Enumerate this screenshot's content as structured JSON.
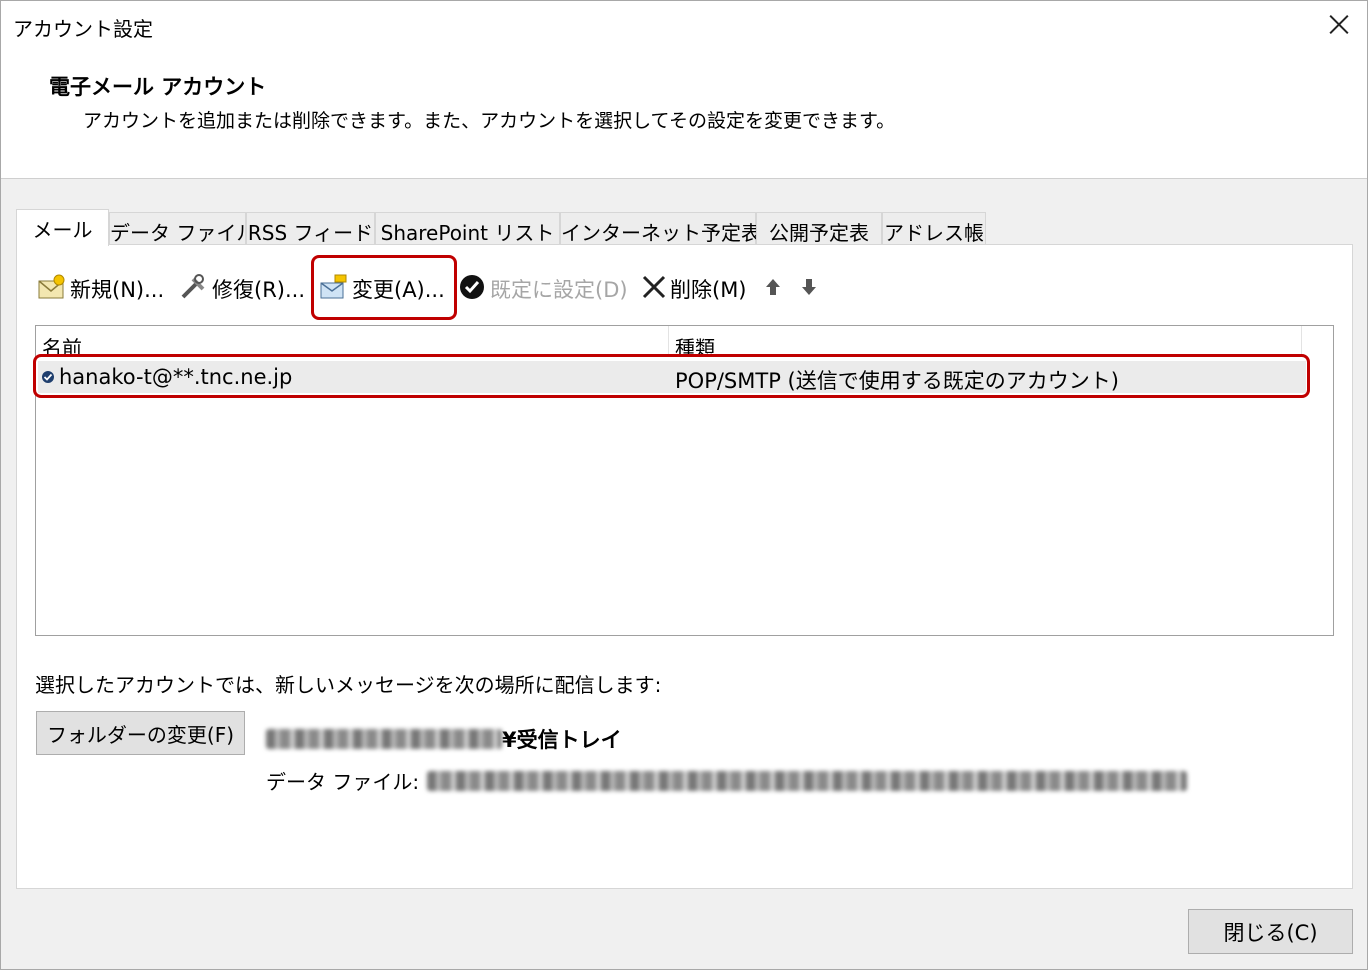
{
  "window": {
    "title": "アカウント設定"
  },
  "header": {
    "heading": "電子メール アカウント",
    "description": "アカウントを追加または削除できます。また、アカウントを選択してその設定を変更できます。"
  },
  "tabs": [
    {
      "label": "メール",
      "active": true
    },
    {
      "label": "データ ファイル"
    },
    {
      "label": "RSS フィード"
    },
    {
      "label": "SharePoint リスト"
    },
    {
      "label": "インターネット予定表"
    },
    {
      "label": "公開予定表"
    },
    {
      "label": "アドレス帳"
    }
  ],
  "toolbar": {
    "new": "新規(N)...",
    "repair": "修復(R)...",
    "change": "変更(A)...",
    "set_default": "既定に設定(D)",
    "remove": "削除(M)"
  },
  "list": {
    "columns": [
      "名前",
      "種類"
    ],
    "rows": [
      {
        "name": "hanako-t@**.tnc.ne.jp",
        "type": "POP/SMTP (送信で使用する既定のアカウント)"
      }
    ]
  },
  "delivery": {
    "label": "選択したアカウントでは、新しいメッセージを次の場所に配信します:",
    "folder_button": "フォルダーの変更(F)",
    "inbox_suffix": "¥受信トレイ",
    "data_file_label": "データ ファイル:"
  },
  "footer": {
    "close_button": "閉じる(C)"
  },
  "colors": {
    "highlight": "#c00000",
    "button_face": "#e1e1e1"
  }
}
